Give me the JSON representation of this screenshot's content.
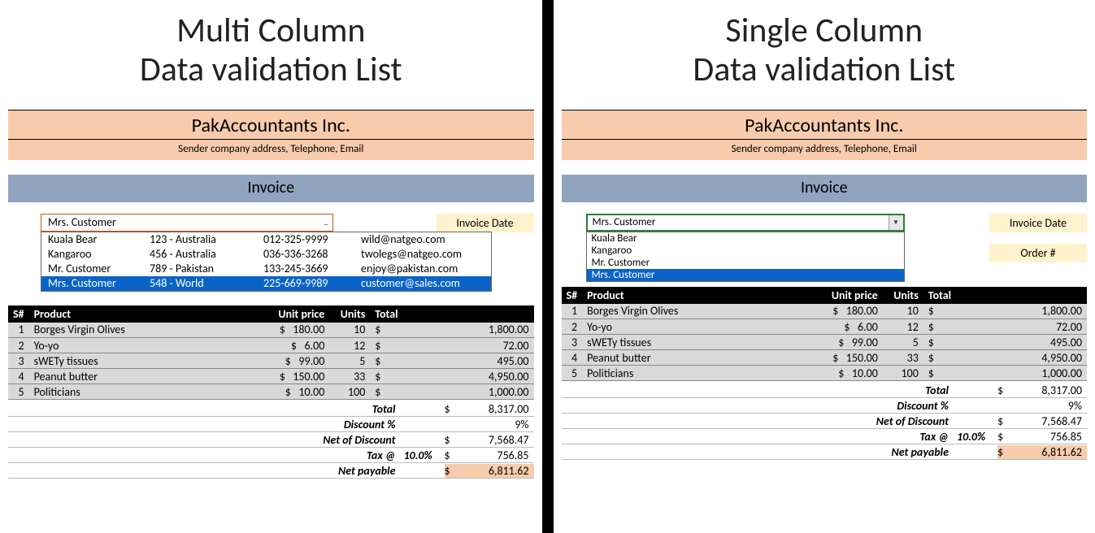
{
  "left": {
    "headline_l1": "Multi Column",
    "headline_l2": "Data validation List",
    "company_name": "PakAccountants Inc.",
    "company_sub": "Sender company address, Telephone, Email",
    "invoice_label": "Invoice",
    "combo_value": "Mrs. Customer",
    "combo_caret": "...",
    "dropdown": [
      {
        "name": "Kuala Bear",
        "addr": "123 - Australia",
        "phone": "012-325-9999",
        "email": "wild@natgeo.com",
        "sel": false
      },
      {
        "name": "Kangaroo",
        "addr": "456 - Australia",
        "phone": "036-336-3268",
        "email": "twolegs@natgeo.com",
        "sel": false
      },
      {
        "name": "Mr. Customer",
        "addr": "789 - Pakistan",
        "phone": "133-245-3669",
        "email": "enjoy@pakistan.com",
        "sel": false
      },
      {
        "name": "Mrs. Customer",
        "addr": "548 - World",
        "phone": "225-669-9989",
        "email": "customer@sales.com",
        "sel": true
      }
    ],
    "invoice_date_label": "Invoice Date"
  },
  "right": {
    "headline_l1": "Single Column",
    "headline_l2": "Data validation List",
    "company_name": "PakAccountants Inc.",
    "company_sub": "Sender company address, Telephone, Email",
    "invoice_label": "Invoice",
    "combo_value": "Mrs. Customer",
    "dropdown": [
      {
        "name": "Kuala Bear",
        "sel": false
      },
      {
        "name": "Kangaroo",
        "sel": false
      },
      {
        "name": "Mr. Customer",
        "sel": false
      },
      {
        "name": "Mrs. Customer",
        "sel": true
      }
    ],
    "invoice_date_label": "Invoice Date",
    "order_label": "Order #"
  },
  "table": {
    "headers": {
      "sn": "S#",
      "product": "Product",
      "unit_price": "Unit price",
      "units": "Units",
      "total": "Total"
    },
    "currency": "$",
    "rows": [
      {
        "sn": "1",
        "product": "Borges Virgin Olives",
        "unit_price": "180.00",
        "units": "10",
        "total": "1,800.00"
      },
      {
        "sn": "2",
        "product": "Yo-yo",
        "unit_price": "6.00",
        "units": "12",
        "total": "72.00"
      },
      {
        "sn": "3",
        "product": "sWETy tissues",
        "unit_price": "99.00",
        "units": "5",
        "total": "495.00"
      },
      {
        "sn": "4",
        "product": "Peanut butter",
        "unit_price": "150.00",
        "units": "33",
        "total": "4,950.00"
      },
      {
        "sn": "5",
        "product": "Politicians",
        "unit_price": "10.00",
        "units": "100",
        "total": "1,000.00"
      }
    ]
  },
  "summary": {
    "total_lbl": "Total",
    "total_val": "8,317.00",
    "discount_pct_lbl": "Discount %",
    "discount_pct_val": "9%",
    "net_discount_lbl": "Net of Discount",
    "net_discount_val": "7,568.47",
    "tax_lbl": "Tax @",
    "tax_pct": "10.0%",
    "tax_val": "756.85",
    "net_payable_lbl": "Net payable",
    "net_payable_val": "6,811.62",
    "currency": "$"
  }
}
